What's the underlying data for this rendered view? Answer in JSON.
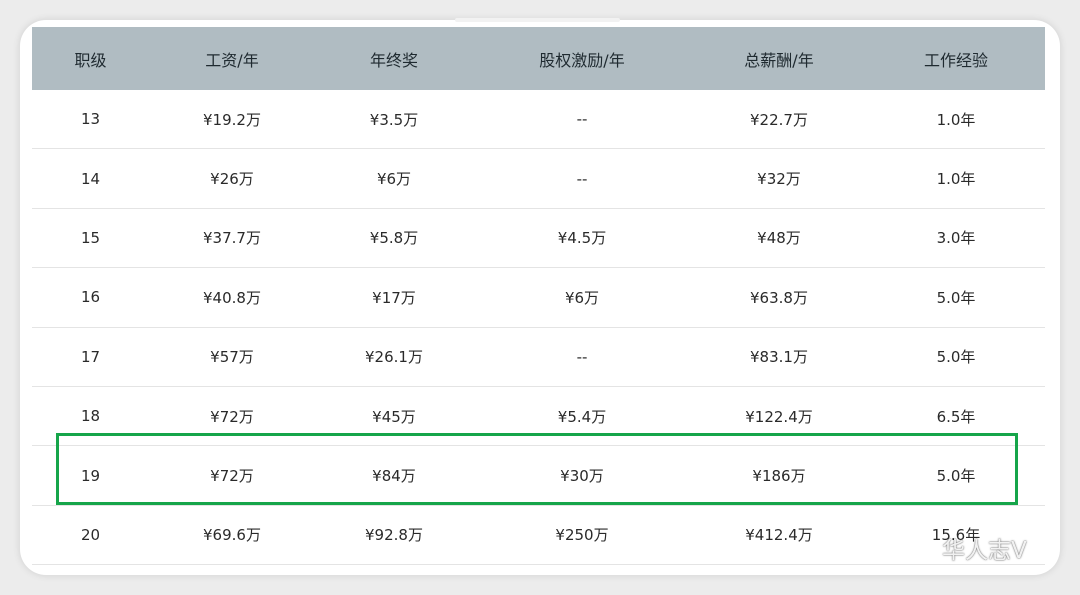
{
  "table": {
    "headers": [
      "职级",
      "工资/年",
      "年终奖",
      "股权激励/年",
      "总薪酬/年",
      "工作经验"
    ],
    "rows": [
      [
        "13",
        "¥19.2万",
        "¥3.5万",
        "--",
        "¥22.7万",
        "1.0年"
      ],
      [
        "14",
        "¥26万",
        "¥6万",
        "--",
        "¥32万",
        "1.0年"
      ],
      [
        "15",
        "¥37.7万",
        "¥5.8万",
        "¥4.5万",
        "¥48万",
        "3.0年"
      ],
      [
        "16",
        "¥40.8万",
        "¥17万",
        "¥6万",
        "¥63.8万",
        "5.0年"
      ],
      [
        "17",
        "¥57万",
        "¥26.1万",
        "--",
        "¥83.1万",
        "5.0年"
      ],
      [
        "18",
        "¥72万",
        "¥45万",
        "¥5.4万",
        "¥122.4万",
        "6.5年"
      ],
      [
        "19",
        "¥72万",
        "¥84万",
        "¥30万",
        "¥186万",
        "5.0年"
      ],
      [
        "20",
        "¥69.6万",
        "¥92.8万",
        "¥250万",
        "¥412.4万",
        "15.6年"
      ]
    ],
    "highlighted_row": "19"
  },
  "watermark": {
    "text": "华人志V",
    "icon": "wechat-icon"
  },
  "colors": {
    "header_bg": "#b0bcc2",
    "highlight": "#16a54a",
    "row_divider": "#e4e4e4"
  }
}
